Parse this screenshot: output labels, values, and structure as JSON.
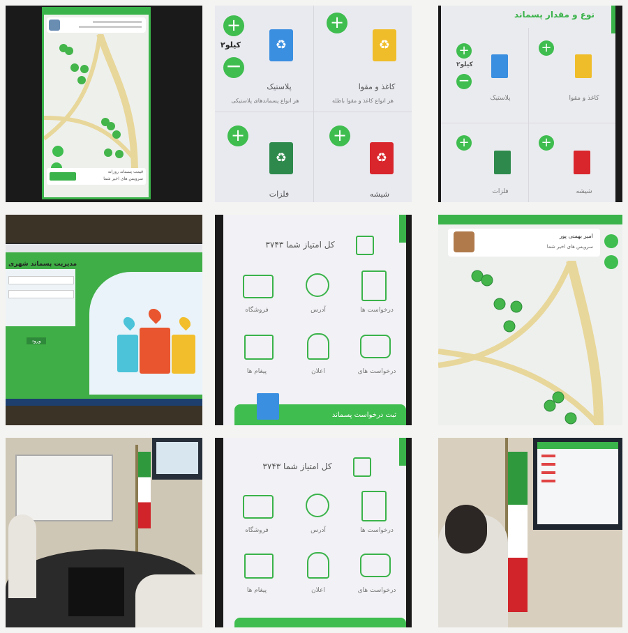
{
  "tiles": {
    "app_map_phone": {
      "legend_line1": "قیمت پسماند روزانه",
      "legend_line2": "سرویس های اخیر شما"
    },
    "bins_grid": {
      "top_left": {
        "weight": "۲کیلو",
        "name": "پلاستیک",
        "subtitle": "هر انواع پسماندهای پلاستیکی"
      },
      "top_right": {
        "name": "کاغذ و مقوا",
        "subtitle": "هر انواع کاغذ و مقوا باطله"
      },
      "bottom_left": {
        "name": "فلزات"
      },
      "bottom_right": {
        "name": "شیشه"
      }
    },
    "bins_grid_small": {
      "header": "نوع و مقدار پسماند",
      "weight": "۲کیلو",
      "labels": [
        "کاغذ و مقوا",
        "پلاستیک",
        "شیشه",
        "فلزات"
      ]
    },
    "desktop_login": {
      "title": "مدیریت پسماند شهری",
      "button": "ورود"
    },
    "score_menu": {
      "score_text": "کل امتیاز شما ۳۷۴۳",
      "items": [
        "درخواست ها",
        "آدرس",
        "فروشگاه",
        "درخواست های",
        "اعلان",
        "پیغام ها"
      ],
      "banner": "ثبت درخواست پسماند"
    },
    "map_zoom": {
      "name_line": "امیر بهمنی پور",
      "sub_line": "سرویس های اخیر شما"
    },
    "score_menu_2": {
      "score_text": "کل امتیاز شما ۳۷۴۳",
      "items": [
        "درخواست ها",
        "آدرس",
        "فروشگاه",
        "درخواست های",
        "اعلان",
        "پیغام ها"
      ]
    }
  }
}
